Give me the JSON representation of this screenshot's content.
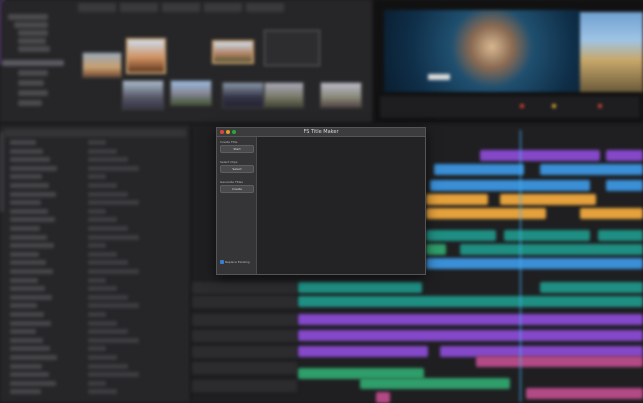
{
  "dialog": {
    "title": "FS Title Maker",
    "groups": [
      {
        "label": "Create Title",
        "button": "Start"
      },
      {
        "label": "Select Clips",
        "button": "Select"
      },
      {
        "label": "Generate Titles",
        "button": "Create"
      }
    ],
    "option": {
      "label": "Replace Existing",
      "checked": true
    }
  },
  "colors": {
    "accent_purple": "#8b3ec4",
    "clip_blue": "#3a8fd6",
    "clip_purple": "#8448c9",
    "clip_teal": "#1f8f83",
    "clip_orange": "#e5a13c",
    "clip_pink": "#b34a86",
    "clip_green": "#2f9e6a",
    "playhead": "#3fb6ff"
  }
}
